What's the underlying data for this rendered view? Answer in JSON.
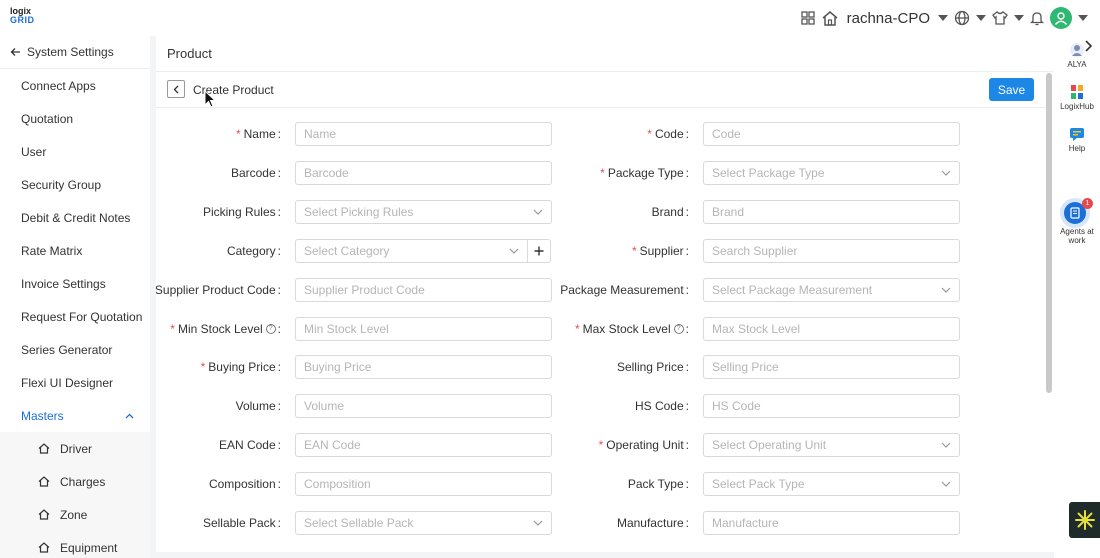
{
  "topbar": {
    "logo_line1": "logix",
    "logo_line2": "GRID",
    "user_name": "rachna-CPO",
    "icons": [
      "apps-grid-icon",
      "home-icon",
      "globe-icon",
      "shirt-icon",
      "bell-icon",
      "user-avatar-icon"
    ]
  },
  "sidebar": {
    "back_label": "System Settings",
    "items": [
      "Connect Apps",
      "Quotation",
      "User",
      "Security Group",
      "Debit & Credit Notes",
      "Rate Matrix",
      "Invoice Settings",
      "Request For Quotation",
      "Series Generator",
      "Flexi UI Designer"
    ],
    "active_item": "Masters",
    "sub_items": [
      "Driver",
      "Charges",
      "Zone",
      "Equipment"
    ]
  },
  "main": {
    "title": "Product",
    "subtitle": "Create Product",
    "save_label": "Save"
  },
  "form": {
    "left": [
      {
        "label": "Name",
        "required": true,
        "placeholder": "Name",
        "type": "text"
      },
      {
        "label": "Barcode",
        "required": false,
        "placeholder": "Barcode",
        "type": "text"
      },
      {
        "label": "Picking Rules",
        "required": false,
        "placeholder": "Select Picking Rules",
        "type": "select"
      },
      {
        "label": "Category",
        "required": false,
        "placeholder": "Select Category",
        "type": "select-add"
      },
      {
        "label": "Supplier Product Code",
        "required": true,
        "placeholder": "Supplier Product Code",
        "type": "text"
      },
      {
        "label": "Min Stock Level",
        "required": true,
        "placeholder": "Min Stock Level",
        "type": "text",
        "help": true
      },
      {
        "label": "Buying Price",
        "required": true,
        "placeholder": "Buying Price",
        "type": "text"
      },
      {
        "label": "Volume",
        "required": false,
        "placeholder": "Volume",
        "type": "text"
      },
      {
        "label": "EAN Code",
        "required": false,
        "placeholder": "EAN Code",
        "type": "text"
      },
      {
        "label": "Composition",
        "required": false,
        "placeholder": "Composition",
        "type": "text"
      },
      {
        "label": "Sellable Pack",
        "required": false,
        "placeholder": "Select Sellable Pack",
        "type": "select"
      }
    ],
    "right": [
      {
        "label": "Code",
        "required": true,
        "placeholder": "Code",
        "type": "text"
      },
      {
        "label": "Package Type",
        "required": true,
        "placeholder": "Select Package Type",
        "type": "select"
      },
      {
        "label": "Brand",
        "required": false,
        "placeholder": "Brand",
        "type": "text"
      },
      {
        "label": "Supplier",
        "required": true,
        "placeholder": "Search Supplier",
        "type": "text"
      },
      {
        "label": "Package Measurement",
        "required": false,
        "placeholder": "Select Package Measurement",
        "type": "select"
      },
      {
        "label": "Max Stock Level",
        "required": true,
        "placeholder": "Max Stock Level",
        "type": "text",
        "help": true
      },
      {
        "label": "Selling Price",
        "required": false,
        "placeholder": "Selling Price",
        "type": "text"
      },
      {
        "label": "HS Code",
        "required": false,
        "placeholder": "HS Code",
        "type": "text"
      },
      {
        "label": "Operating Unit",
        "required": true,
        "placeholder": "Select Operating Unit",
        "type": "select"
      },
      {
        "label": "Pack Type",
        "required": false,
        "placeholder": "Select Pack Type",
        "type": "select"
      },
      {
        "label": "Manufacture",
        "required": false,
        "placeholder": "Manufacture",
        "type": "text"
      }
    ]
  },
  "rightbar": {
    "items": [
      {
        "label": "ALYA",
        "icon": "alya-icon"
      },
      {
        "label": "LogixHub",
        "icon": "logixhub-icon"
      },
      {
        "label": "Help",
        "icon": "help-chat-icon"
      }
    ],
    "agents_label_line1": "Agents at",
    "agents_label_line2": "work",
    "agents_badge": "1"
  },
  "colors": {
    "accent": "#1d87e5",
    "required": "#e35050",
    "avatar": "#2eb872"
  }
}
